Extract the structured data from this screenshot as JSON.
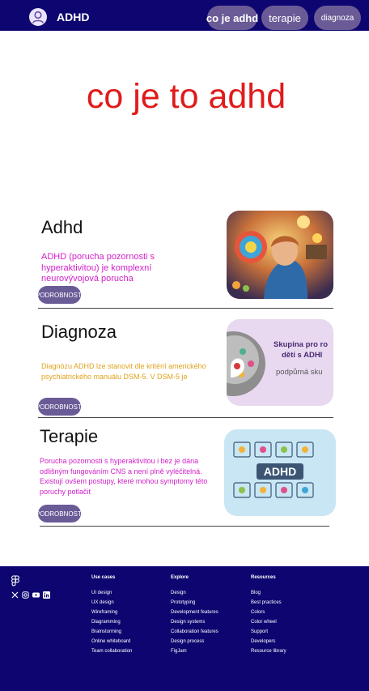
{
  "header": {
    "brand": "ADHD",
    "nav": [
      {
        "label": "co je adhd"
      },
      {
        "label": "terapie"
      },
      {
        "label": "diagnoza"
      }
    ]
  },
  "hero": {
    "title": "co je to adhd"
  },
  "sections": [
    {
      "title": "Adhd",
      "description": "ADHD (porucha pozornosti s hyperaktivitou) je komplexní neurovývojová porucha",
      "button": "PODROBNOSTI",
      "desc_color": "#d21fc9"
    },
    {
      "title": "Diagnoza",
      "description": "Diagnózu ADHD lze stanovit dle kritérií amerického psychiatrického manuálu DSM-5. V DSM-5 je",
      "button": "PODROBNOSTI",
      "desc_color": "#e0a21d",
      "image_text": {
        "line1": "Skupina pro ro",
        "line2": "dětí s ADHI",
        "line3": "podpůrná sku"
      }
    },
    {
      "title": "Terapie",
      "description": "Porucha pozornosti s hyperaktivitou i bez je dána odlišným fungováním CNS a není plně vyléčitelná. Existují ovšem postupy, které mohou symptomy této poruchy potlačit",
      "button": "PODROBNOSTI",
      "desc_color": "#d21fc9",
      "image_text": {
        "badge": "ADHD"
      }
    }
  ],
  "footer": {
    "columns": [
      {
        "heading": "Use cases",
        "links": [
          "UI design",
          "UX design",
          "Wireframing",
          "Diagramming",
          "Brainstorming",
          "Online whiteboard",
          "Team collaboration"
        ]
      },
      {
        "heading": "Explore",
        "links": [
          "Design",
          "Prototyping",
          "Development features",
          "Design systems",
          "Collaboration features",
          "Design process",
          "FigJam"
        ]
      },
      {
        "heading": "Resources",
        "links": [
          "Blog",
          "Best practices",
          "Colors",
          "Color wheel",
          "Support",
          "Developers",
          "Resource library"
        ]
      }
    ],
    "social_icons": [
      "x-icon",
      "instagram-icon",
      "youtube-icon",
      "linkedin-icon"
    ]
  },
  "colors": {
    "navy": "#0d0670",
    "pill": "#6a5b97",
    "hero_red": "#e01b1b"
  }
}
